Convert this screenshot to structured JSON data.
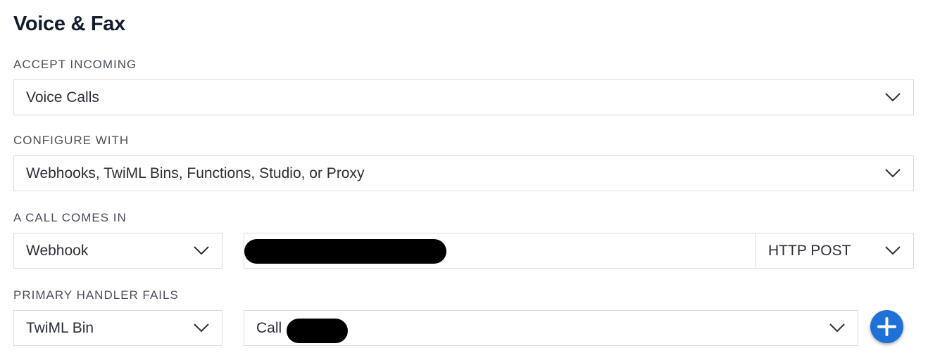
{
  "section": {
    "title": "Voice & Fax"
  },
  "accept_incoming": {
    "label": "ACCEPT INCOMING",
    "value": "Voice Calls"
  },
  "configure_with": {
    "label": "CONFIGURE WITH",
    "value": "Webhooks, TwiML Bins, Functions, Studio, or Proxy"
  },
  "call_comes_in": {
    "label": "A CALL COMES IN",
    "type_value": "Webhook",
    "url_value": "",
    "method_value": "HTTP POST"
  },
  "primary_handler_fails": {
    "label": "PRIMARY HANDLER FAILS",
    "type_value": "TwiML Bin",
    "bin_value": "Call"
  },
  "icons": {
    "dropdown": "chevron-down-icon",
    "add": "plus-icon"
  },
  "colors": {
    "accent": "#1f71d6",
    "border": "#d8dbe0",
    "label": "#4a4f5a",
    "text": "#2b2f38"
  }
}
